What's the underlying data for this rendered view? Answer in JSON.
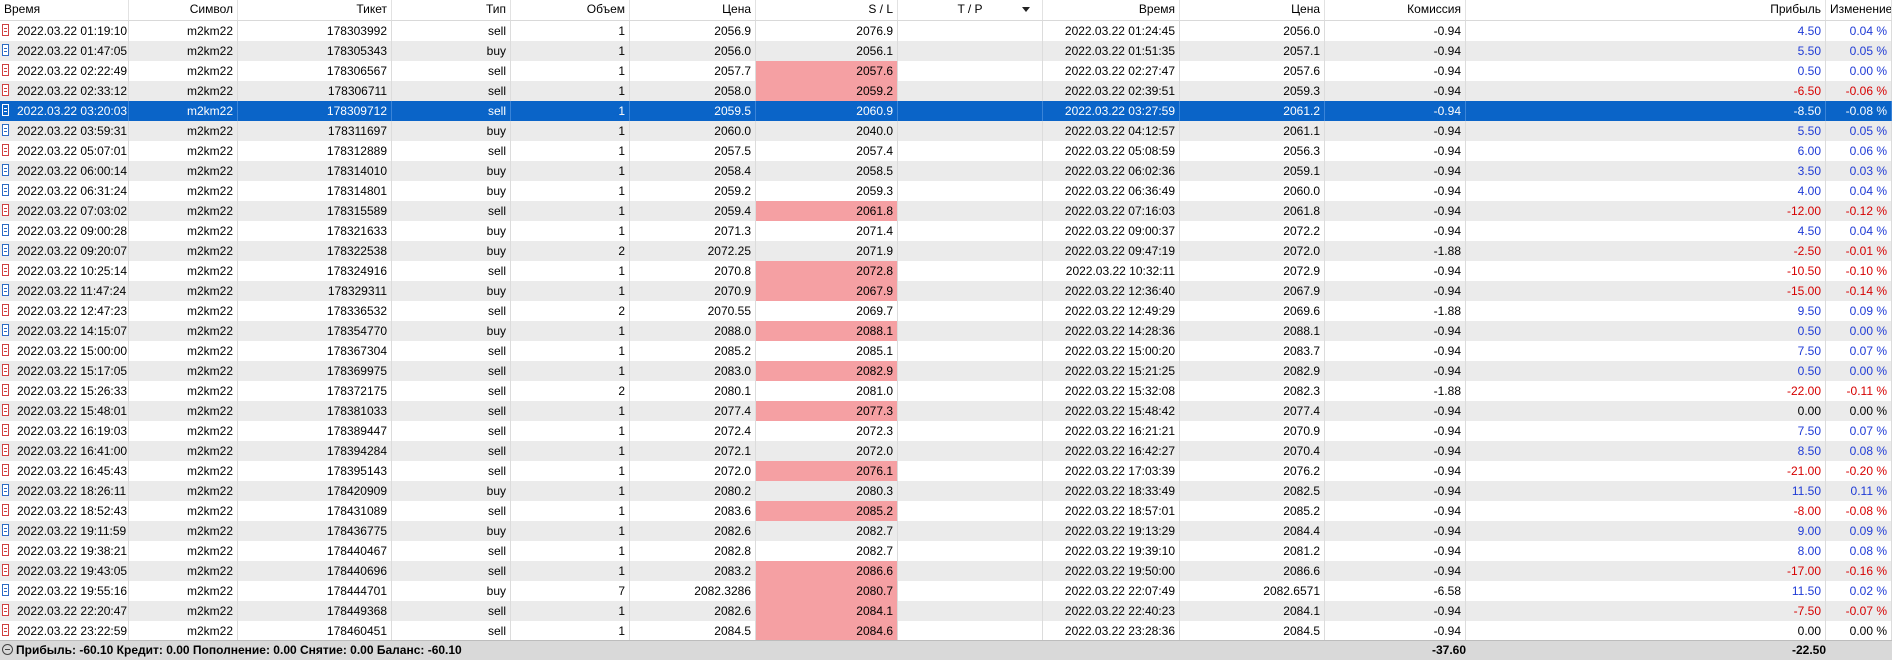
{
  "columns": [
    {
      "key": "open_time",
      "label": "Время",
      "align": "l"
    },
    {
      "key": "symbol",
      "label": "Символ",
      "align": "r"
    },
    {
      "key": "ticket",
      "label": "Тикет",
      "align": "r"
    },
    {
      "key": "type",
      "label": "Тип",
      "align": "r"
    },
    {
      "key": "volume",
      "label": "Объем",
      "align": "r"
    },
    {
      "key": "price",
      "label": "Цена",
      "align": "r"
    },
    {
      "key": "sl",
      "label": "S / L",
      "align": "r"
    },
    {
      "key": "tp",
      "label": "T / P",
      "align": "r"
    },
    {
      "key": "close_time",
      "label": "Время",
      "align": "r"
    },
    {
      "key": "close_price",
      "label": "Цена",
      "align": "r"
    },
    {
      "key": "commission",
      "label": "Комиссия",
      "align": "r"
    },
    {
      "key": "profit",
      "label": "Прибыль",
      "align": "r"
    },
    {
      "key": "change",
      "label": "Изменение",
      "align": "r"
    }
  ],
  "rows": [
    {
      "open_time": "2022.03.22 01:19:10",
      "symbol": "m2km22",
      "ticket": "178303992",
      "type": "sell",
      "volume": "1",
      "price": "2056.9",
      "sl": "2076.9",
      "tp": "",
      "close_time": "2022.03.22 01:24:45",
      "close_price": "2056.0",
      "commission": "-0.94",
      "profit": "4.50",
      "change": "0.04 %",
      "sl_hit": false,
      "sign": "pos"
    },
    {
      "open_time": "2022.03.22 01:47:05",
      "symbol": "m2km22",
      "ticket": "178305343",
      "type": "buy",
      "volume": "1",
      "price": "2056.0",
      "sl": "2056.1",
      "tp": "",
      "close_time": "2022.03.22 01:51:35",
      "close_price": "2057.1",
      "commission": "-0.94",
      "profit": "5.50",
      "change": "0.05 %",
      "sl_hit": false,
      "sign": "pos"
    },
    {
      "open_time": "2022.03.22 02:22:49",
      "symbol": "m2km22",
      "ticket": "178306567",
      "type": "sell",
      "volume": "1",
      "price": "2057.7",
      "sl": "2057.6",
      "tp": "",
      "close_time": "2022.03.22 02:27:47",
      "close_price": "2057.6",
      "commission": "-0.94",
      "profit": "0.50",
      "change": "0.00 %",
      "sl_hit": true,
      "sign": "pos"
    },
    {
      "open_time": "2022.03.22 02:33:12",
      "symbol": "m2km22",
      "ticket": "178306711",
      "type": "sell",
      "volume": "1",
      "price": "2058.0",
      "sl": "2059.2",
      "tp": "",
      "close_time": "2022.03.22 02:39:51",
      "close_price": "2059.3",
      "commission": "-0.94",
      "profit": "-6.50",
      "change": "-0.06 %",
      "sl_hit": true,
      "sign": "neg"
    },
    {
      "open_time": "2022.03.22 03:20:03",
      "symbol": "m2km22",
      "ticket": "178309712",
      "type": "sell",
      "volume": "1",
      "price": "2059.5",
      "sl": "2060.9",
      "tp": "",
      "close_time": "2022.03.22 03:27:59",
      "close_price": "2061.2",
      "commission": "-0.94",
      "profit": "-8.50",
      "change": "-0.08 %",
      "sl_hit": false,
      "sign": "neg",
      "selected": true
    },
    {
      "open_time": "2022.03.22 03:59:31",
      "symbol": "m2km22",
      "ticket": "178311697",
      "type": "buy",
      "volume": "1",
      "price": "2060.0",
      "sl": "2040.0",
      "tp": "",
      "close_time": "2022.03.22 04:12:57",
      "close_price": "2061.1",
      "commission": "-0.94",
      "profit": "5.50",
      "change": "0.05 %",
      "sl_hit": false,
      "sign": "pos"
    },
    {
      "open_time": "2022.03.22 05:07:01",
      "symbol": "m2km22",
      "ticket": "178312889",
      "type": "sell",
      "volume": "1",
      "price": "2057.5",
      "sl": "2057.4",
      "tp": "",
      "close_time": "2022.03.22 05:08:59",
      "close_price": "2056.3",
      "commission": "-0.94",
      "profit": "6.00",
      "change": "0.06 %",
      "sl_hit": false,
      "sign": "pos"
    },
    {
      "open_time": "2022.03.22 06:00:14",
      "symbol": "m2km22",
      "ticket": "178314010",
      "type": "buy",
      "volume": "1",
      "price": "2058.4",
      "sl": "2058.5",
      "tp": "",
      "close_time": "2022.03.22 06:02:36",
      "close_price": "2059.1",
      "commission": "-0.94",
      "profit": "3.50",
      "change": "0.03 %",
      "sl_hit": false,
      "sign": "pos"
    },
    {
      "open_time": "2022.03.22 06:31:24",
      "symbol": "m2km22",
      "ticket": "178314801",
      "type": "buy",
      "volume": "1",
      "price": "2059.2",
      "sl": "2059.3",
      "tp": "",
      "close_time": "2022.03.22 06:36:49",
      "close_price": "2060.0",
      "commission": "-0.94",
      "profit": "4.00",
      "change": "0.04 %",
      "sl_hit": false,
      "sign": "pos"
    },
    {
      "open_time": "2022.03.22 07:03:02",
      "symbol": "m2km22",
      "ticket": "178315589",
      "type": "sell",
      "volume": "1",
      "price": "2059.4",
      "sl": "2061.8",
      "tp": "",
      "close_time": "2022.03.22 07:16:03",
      "close_price": "2061.8",
      "commission": "-0.94",
      "profit": "-12.00",
      "change": "-0.12 %",
      "sl_hit": true,
      "sign": "neg"
    },
    {
      "open_time": "2022.03.22 09:00:28",
      "symbol": "m2km22",
      "ticket": "178321633",
      "type": "buy",
      "volume": "1",
      "price": "2071.3",
      "sl": "2071.4",
      "tp": "",
      "close_time": "2022.03.22 09:00:37",
      "close_price": "2072.2",
      "commission": "-0.94",
      "profit": "4.50",
      "change": "0.04 %",
      "sl_hit": false,
      "sign": "pos"
    },
    {
      "open_time": "2022.03.22 09:20:07",
      "symbol": "m2km22",
      "ticket": "178322538",
      "type": "buy",
      "volume": "2",
      "price": "2072.25",
      "sl": "2071.9",
      "tp": "",
      "close_time": "2022.03.22 09:47:19",
      "close_price": "2072.0",
      "commission": "-1.88",
      "profit": "-2.50",
      "change": "-0.01 %",
      "sl_hit": false,
      "sign": "neg"
    },
    {
      "open_time": "2022.03.22 10:25:14",
      "symbol": "m2km22",
      "ticket": "178324916",
      "type": "sell",
      "volume": "1",
      "price": "2070.8",
      "sl": "2072.8",
      "tp": "",
      "close_time": "2022.03.22 10:32:11",
      "close_price": "2072.9",
      "commission": "-0.94",
      "profit": "-10.50",
      "change": "-0.10 %",
      "sl_hit": true,
      "sign": "neg"
    },
    {
      "open_time": "2022.03.22 11:47:24",
      "symbol": "m2km22",
      "ticket": "178329311",
      "type": "buy",
      "volume": "1",
      "price": "2070.9",
      "sl": "2067.9",
      "tp": "",
      "close_time": "2022.03.22 12:36:40",
      "close_price": "2067.9",
      "commission": "-0.94",
      "profit": "-15.00",
      "change": "-0.14 %",
      "sl_hit": true,
      "sign": "neg"
    },
    {
      "open_time": "2022.03.22 12:47:23",
      "symbol": "m2km22",
      "ticket": "178336532",
      "type": "sell",
      "volume": "2",
      "price": "2070.55",
      "sl": "2069.7",
      "tp": "",
      "close_time": "2022.03.22 12:49:29",
      "close_price": "2069.6",
      "commission": "-1.88",
      "profit": "9.50",
      "change": "0.09 %",
      "sl_hit": false,
      "sign": "pos"
    },
    {
      "open_time": "2022.03.22 14:15:07",
      "symbol": "m2km22",
      "ticket": "178354770",
      "type": "buy",
      "volume": "1",
      "price": "2088.0",
      "sl": "2088.1",
      "tp": "",
      "close_time": "2022.03.22 14:28:36",
      "close_price": "2088.1",
      "commission": "-0.94",
      "profit": "0.50",
      "change": "0.00 %",
      "sl_hit": true,
      "sign": "pos"
    },
    {
      "open_time": "2022.03.22 15:00:00",
      "symbol": "m2km22",
      "ticket": "178367304",
      "type": "sell",
      "volume": "1",
      "price": "2085.2",
      "sl": "2085.1",
      "tp": "",
      "close_time": "2022.03.22 15:00:20",
      "close_price": "2083.7",
      "commission": "-0.94",
      "profit": "7.50",
      "change": "0.07 %",
      "sl_hit": false,
      "sign": "pos"
    },
    {
      "open_time": "2022.03.22 15:17:05",
      "symbol": "m2km22",
      "ticket": "178369975",
      "type": "sell",
      "volume": "1",
      "price": "2083.0",
      "sl": "2082.9",
      "tp": "",
      "close_time": "2022.03.22 15:21:25",
      "close_price": "2082.9",
      "commission": "-0.94",
      "profit": "0.50",
      "change": "0.00 %",
      "sl_hit": true,
      "sign": "pos"
    },
    {
      "open_time": "2022.03.22 15:26:33",
      "symbol": "m2km22",
      "ticket": "178372175",
      "type": "sell",
      "volume": "2",
      "price": "2080.1",
      "sl": "2081.0",
      "tp": "",
      "close_time": "2022.03.22 15:32:08",
      "close_price": "2082.3",
      "commission": "-1.88",
      "profit": "-22.00",
      "change": "-0.11 %",
      "sl_hit": false,
      "sign": "neg"
    },
    {
      "open_time": "2022.03.22 15:48:01",
      "symbol": "m2km22",
      "ticket": "178381033",
      "type": "sell",
      "volume": "1",
      "price": "2077.4",
      "sl": "2077.3",
      "tp": "",
      "close_time": "2022.03.22 15:48:42",
      "close_price": "2077.4",
      "commission": "-0.94",
      "profit": "0.00",
      "change": "0.00 %",
      "sl_hit": true,
      "sign": "zero"
    },
    {
      "open_time": "2022.03.22 16:19:03",
      "symbol": "m2km22",
      "ticket": "178389447",
      "type": "sell",
      "volume": "1",
      "price": "2072.4",
      "sl": "2072.3",
      "tp": "",
      "close_time": "2022.03.22 16:21:21",
      "close_price": "2070.9",
      "commission": "-0.94",
      "profit": "7.50",
      "change": "0.07 %",
      "sl_hit": false,
      "sign": "pos"
    },
    {
      "open_time": "2022.03.22 16:41:00",
      "symbol": "m2km22",
      "ticket": "178394284",
      "type": "sell",
      "volume": "1",
      "price": "2072.1",
      "sl": "2072.0",
      "tp": "",
      "close_time": "2022.03.22 16:42:27",
      "close_price": "2070.4",
      "commission": "-0.94",
      "profit": "8.50",
      "change": "0.08 %",
      "sl_hit": false,
      "sign": "pos"
    },
    {
      "open_time": "2022.03.22 16:45:43",
      "symbol": "m2km22",
      "ticket": "178395143",
      "type": "sell",
      "volume": "1",
      "price": "2072.0",
      "sl": "2076.1",
      "tp": "",
      "close_time": "2022.03.22 17:03:39",
      "close_price": "2076.2",
      "commission": "-0.94",
      "profit": "-21.00",
      "change": "-0.20 %",
      "sl_hit": true,
      "sign": "neg"
    },
    {
      "open_time": "2022.03.22 18:26:11",
      "symbol": "m2km22",
      "ticket": "178420909",
      "type": "buy",
      "volume": "1",
      "price": "2080.2",
      "sl": "2080.3",
      "tp": "",
      "close_time": "2022.03.22 18:33:49",
      "close_price": "2082.5",
      "commission": "-0.94",
      "profit": "11.50",
      "change": "0.11 %",
      "sl_hit": false,
      "sign": "pos"
    },
    {
      "open_time": "2022.03.22 18:52:43",
      "symbol": "m2km22",
      "ticket": "178431089",
      "type": "sell",
      "volume": "1",
      "price": "2083.6",
      "sl": "2085.2",
      "tp": "",
      "close_time": "2022.03.22 18:57:01",
      "close_price": "2085.2",
      "commission": "-0.94",
      "profit": "-8.00",
      "change": "-0.08 %",
      "sl_hit": true,
      "sign": "neg"
    },
    {
      "open_time": "2022.03.22 19:11:59",
      "symbol": "m2km22",
      "ticket": "178436775",
      "type": "buy",
      "volume": "1",
      "price": "2082.6",
      "sl": "2082.7",
      "tp": "",
      "close_time": "2022.03.22 19:13:29",
      "close_price": "2084.4",
      "commission": "-0.94",
      "profit": "9.00",
      "change": "0.09 %",
      "sl_hit": false,
      "sign": "pos"
    },
    {
      "open_time": "2022.03.22 19:38:21",
      "symbol": "m2km22",
      "ticket": "178440467",
      "type": "sell",
      "volume": "1",
      "price": "2082.8",
      "sl": "2082.7",
      "tp": "",
      "close_time": "2022.03.22 19:39:10",
      "close_price": "2081.2",
      "commission": "-0.94",
      "profit": "8.00",
      "change": "0.08 %",
      "sl_hit": false,
      "sign": "pos"
    },
    {
      "open_time": "2022.03.22 19:43:05",
      "symbol": "m2km22",
      "ticket": "178440696",
      "type": "sell",
      "volume": "1",
      "price": "2083.2",
      "sl": "2086.6",
      "tp": "",
      "close_time": "2022.03.22 19:50:00",
      "close_price": "2086.6",
      "commission": "-0.94",
      "profit": "-17.00",
      "change": "-0.16 %",
      "sl_hit": true,
      "sign": "neg"
    },
    {
      "open_time": "2022.03.22 19:55:16",
      "symbol": "m2km22",
      "ticket": "178444701",
      "type": "buy",
      "volume": "7",
      "price": "2082.3286",
      "sl": "2080.7",
      "tp": "",
      "close_time": "2022.03.22 22:07:49",
      "close_price": "2082.6571",
      "commission": "-6.58",
      "profit": "11.50",
      "change": "0.02 %",
      "sl_hit": true,
      "sign": "pos"
    },
    {
      "open_time": "2022.03.22 22:20:47",
      "symbol": "m2km22",
      "ticket": "178449368",
      "type": "sell",
      "volume": "1",
      "price": "2082.6",
      "sl": "2084.1",
      "tp": "",
      "close_time": "2022.03.22 22:40:23",
      "close_price": "2084.1",
      "commission": "-0.94",
      "profit": "-7.50",
      "change": "-0.07 %",
      "sl_hit": true,
      "sign": "neg"
    },
    {
      "open_time": "2022.03.22 23:22:59",
      "symbol": "m2km22",
      "ticket": "178460451",
      "type": "sell",
      "volume": "1",
      "price": "2084.5",
      "sl": "2084.6",
      "tp": "",
      "close_time": "2022.03.22 23:28:36",
      "close_price": "2084.5",
      "commission": "-0.94",
      "profit": "0.00",
      "change": "0.00 %",
      "sl_hit": true,
      "sign": "zero"
    }
  ],
  "footer": {
    "summary": "Прибыль: -60.10  Кредит: 0.00  Пополнение: 0.00  Снятие: 0.00  Баланс: -60.10",
    "commission_total": "-37.60",
    "profit_total": "-22.50"
  },
  "colors": {
    "selection": "#0a64c8",
    "sl_highlight": "#f5a0a3",
    "profit_pos": "#1f3bd6",
    "profit_neg": "#d60000"
  }
}
